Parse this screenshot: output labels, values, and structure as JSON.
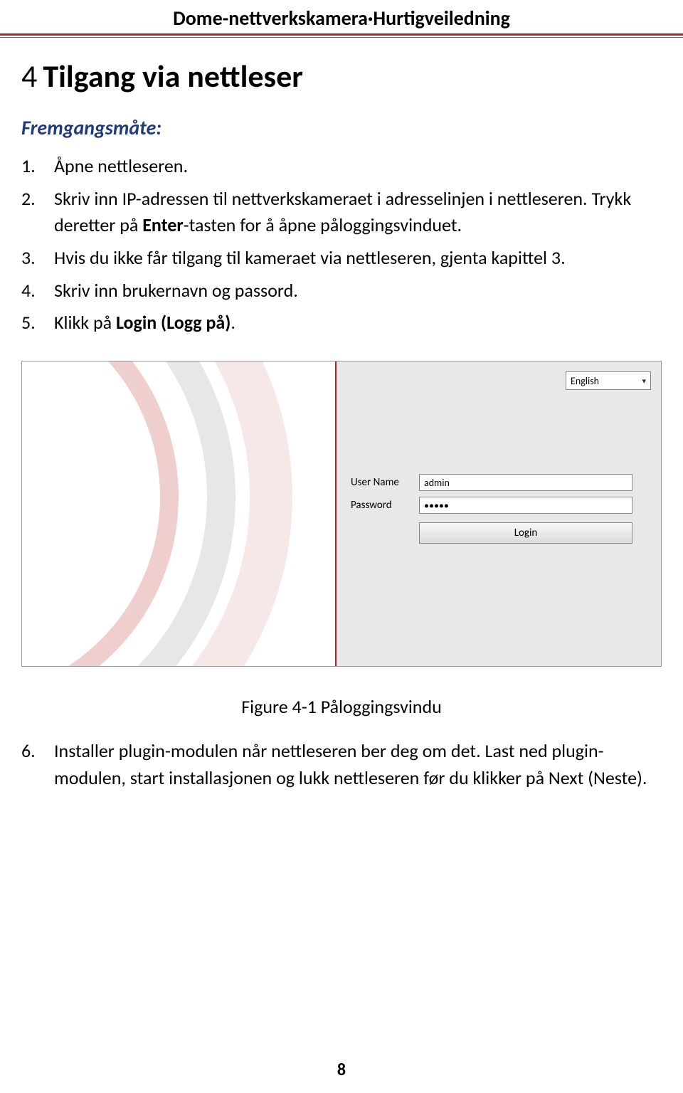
{
  "header": {
    "product": "Dome-nettverkskamera",
    "doc": "Hurtigveiledning"
  },
  "section": {
    "number": "4",
    "title": "Tilgang via nettleser"
  },
  "procedure_label": "Fremgangsmåte:",
  "steps": [
    {
      "n": "1.",
      "html": "Åpne nettleseren."
    },
    {
      "n": "2.",
      "html": "Skriv inn IP-adressen til nettverkskameraet i adresselinjen i nettleseren. Trykk deretter på <b>Enter</b>-tasten for å åpne påloggingsvinduet."
    },
    {
      "n": "3.",
      "html": "Hvis du ikke får tilgang til kameraet via nettleseren, gjenta kapittel 3."
    },
    {
      "n": "4.",
      "html": "Skriv inn brukernavn og passord."
    },
    {
      "n": "5.",
      "html": "Klikk på <b>Login (Logg på)</b>."
    }
  ],
  "login_ui": {
    "language": "English",
    "username_label": "User Name",
    "username_value": "admin",
    "password_label": "Password",
    "password_value": "•••••",
    "login_button": "Login"
  },
  "figure_caption": "Figure 4-1 Påloggingsvindu",
  "step6": {
    "n": "6.",
    "html": "Installer plugin-modulen når nettleseren ber deg om det. Last ned plugin-modulen, start installasjonen og lukk nettleseren før du klikker på Next (Neste)."
  },
  "page_number": "8"
}
